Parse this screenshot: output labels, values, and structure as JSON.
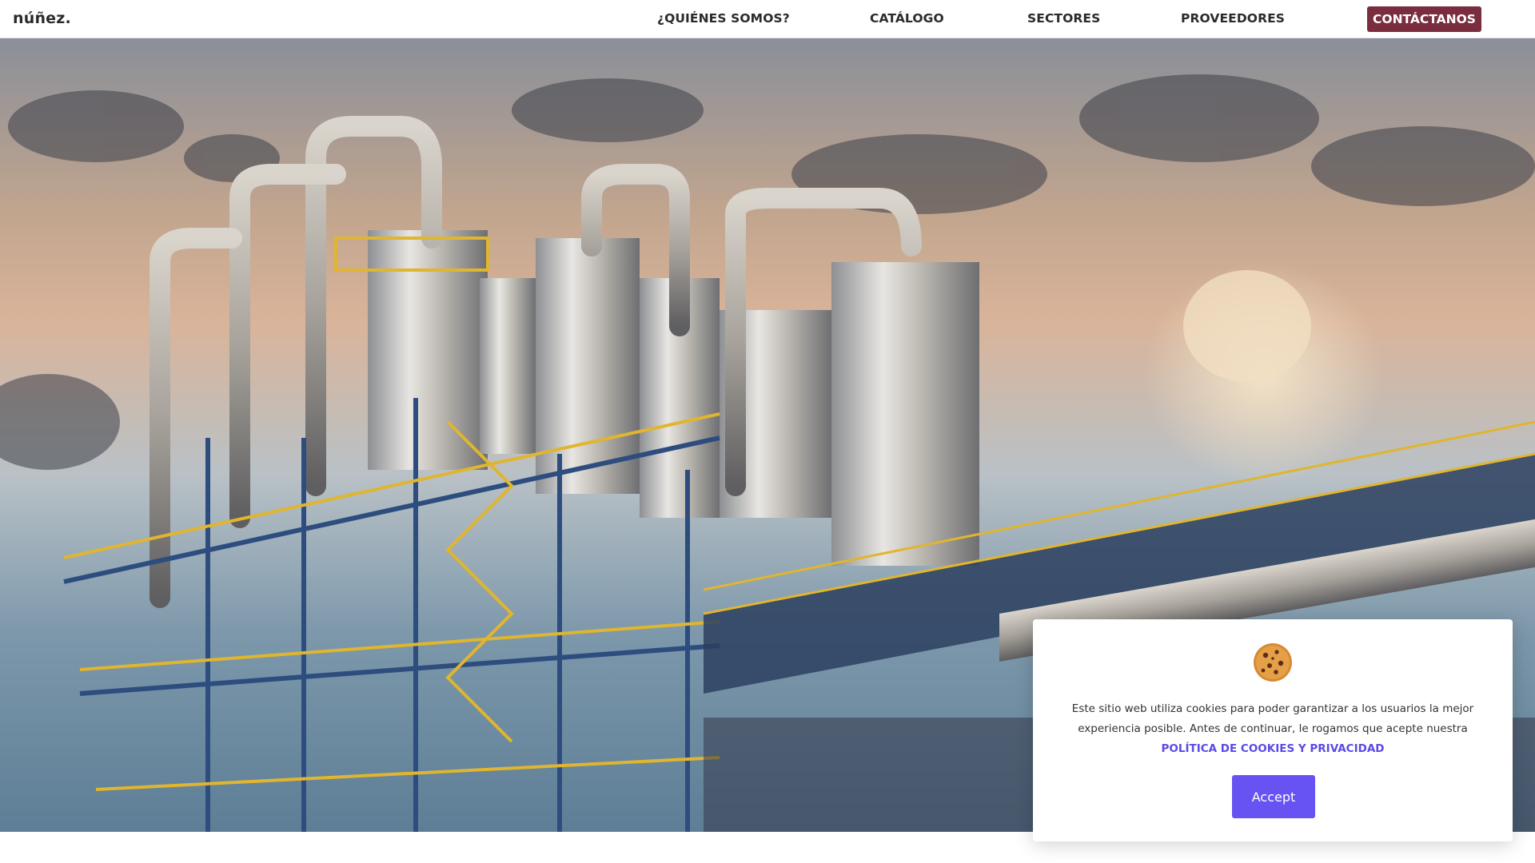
{
  "header": {
    "logo": "núñez.",
    "nav": [
      {
        "label": "¿QUIÉNES SOMOS?"
      },
      {
        "label": "CATÁLOGO"
      },
      {
        "label": "SECTORES"
      },
      {
        "label": "PROVEEDORES"
      }
    ],
    "cta_label": "CONTÁCTANOS",
    "cta_color": "#7a2d3e"
  },
  "hero": {
    "image_subject": "industrial-plant-photo"
  },
  "cookie_banner": {
    "icon": "cookie-icon",
    "text": "Este sitio web utiliza cookies para poder garantizar a los usuarios la mejor experiencia posible. Antes de continuar, le rogamos que acepte nuestra",
    "link_label": "POLÍTICA DE COOKIES Y PRIVACIDAD",
    "accept_label": "Accept",
    "accent_color": "#6653f2"
  }
}
